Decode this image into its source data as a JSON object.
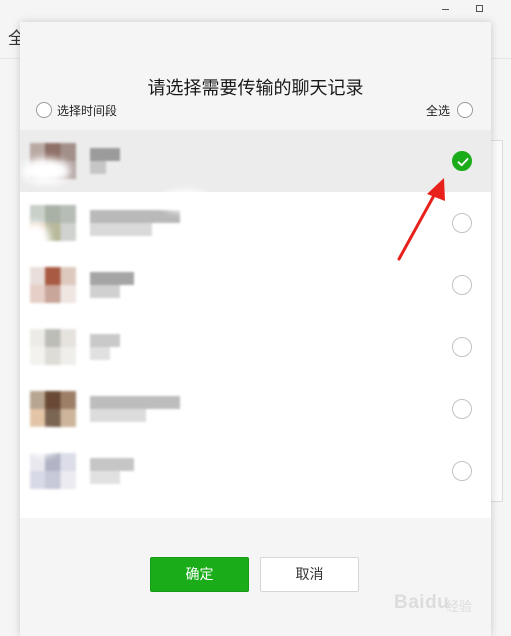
{
  "background": {
    "left_char": "全",
    "window_controls": {
      "minimize_icon": "minimize-icon",
      "maximize_icon": "maximize-icon"
    }
  },
  "dialog": {
    "title": "请选择需要传输的聊天记录",
    "time_range_label": "选择时间段",
    "select_all_label": "全选",
    "confirm_label": "确定",
    "cancel_label": "取消",
    "accent_color": "#1aad19",
    "annotation_arrow_color": "#e8211d"
  },
  "chats": [
    {
      "id": "chat-1",
      "selected": true,
      "avatar": [
        "#b9a9a3",
        "#8e7068",
        "#a28f8a",
        "#c8bcb8",
        "#9f8c8a",
        "#b4a6a4"
      ],
      "name": [
        "#9b9b9b",
        "#c6c6c6"
      ]
    },
    {
      "id": "chat-2",
      "selected": false,
      "avatar": [
        "#c9cfc9",
        "#a9b1a6",
        "#b6bdb6",
        "#e3c9ad",
        "#b8b89b",
        "#cfd2cf"
      ],
      "name": [
        "#b9b9b9",
        "#d9d9d9"
      ]
    },
    {
      "id": "chat-3",
      "selected": false,
      "avatar": [
        "#e9dedb",
        "#a85a43",
        "#ddc9bd",
        "#e6cfc6",
        "#c9a69a",
        "#efe6e2"
      ],
      "name": [
        "#a5a5a5",
        "#d0d0d0"
      ]
    },
    {
      "id": "chat-4",
      "selected": false,
      "avatar": [
        "#ecebe7",
        "#bdbdb7",
        "#e6e3df",
        "#f3f2ef",
        "#dedcd7",
        "#efeeea"
      ],
      "name": [
        "#c9c9c9",
        "#e0e0e0"
      ]
    },
    {
      "id": "chat-5",
      "selected": false,
      "avatar": [
        "#b7a590",
        "#6a4a36",
        "#9d7f68",
        "#e3c5a6",
        "#7b6553",
        "#cdb59c"
      ],
      "name": [
        "#bdbdbd",
        "#dcdcdc"
      ]
    },
    {
      "id": "chat-6",
      "selected": false,
      "avatar": [
        "#e9e8ef",
        "#b2b4c6",
        "#dcdde8",
        "#d8d9e6",
        "#c7c8d8",
        "#ebebf1"
      ],
      "name": [
        "#c6c6c6",
        "#e1e1e1"
      ]
    }
  ],
  "watermark": {
    "text": "Baidu",
    "sub": "经验"
  }
}
